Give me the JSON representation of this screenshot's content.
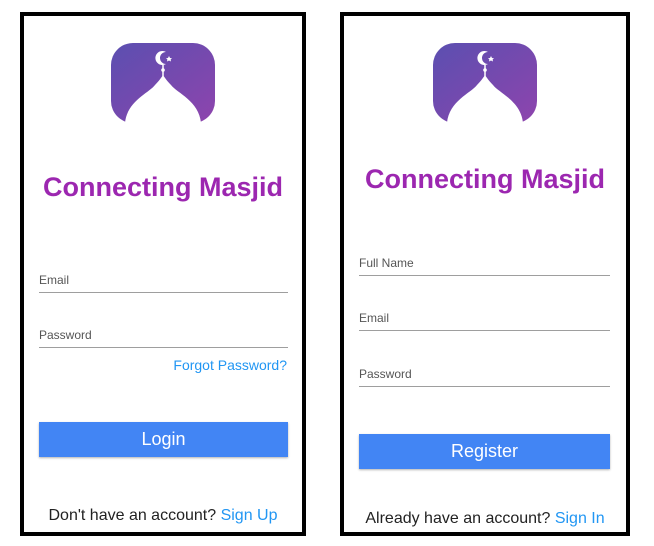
{
  "login": {
    "app_title": "Connecting Masjid",
    "email_placeholder": "Email",
    "password_placeholder": "Password",
    "forgot_password_label": "Forgot Password?",
    "login_button_label": "Login",
    "footer_prompt": "Don't have an account?",
    "footer_link": "Sign Up"
  },
  "register": {
    "app_title": "Connecting Masjid",
    "full_name_placeholder": "Full Name",
    "email_placeholder": "Email",
    "password_placeholder": "Password",
    "register_button_label": "Register",
    "footer_prompt": "Already have an account?",
    "footer_link": "Sign In"
  },
  "colors": {
    "brand_purple": "#9c27b0",
    "logo_gradient_start": "#5b4fb0",
    "logo_gradient_end": "#8e44ad",
    "button_blue": "#4285f4",
    "link_blue": "#2196f3"
  },
  "icons": {
    "logo": "masjid-dome-crescent-icon"
  }
}
